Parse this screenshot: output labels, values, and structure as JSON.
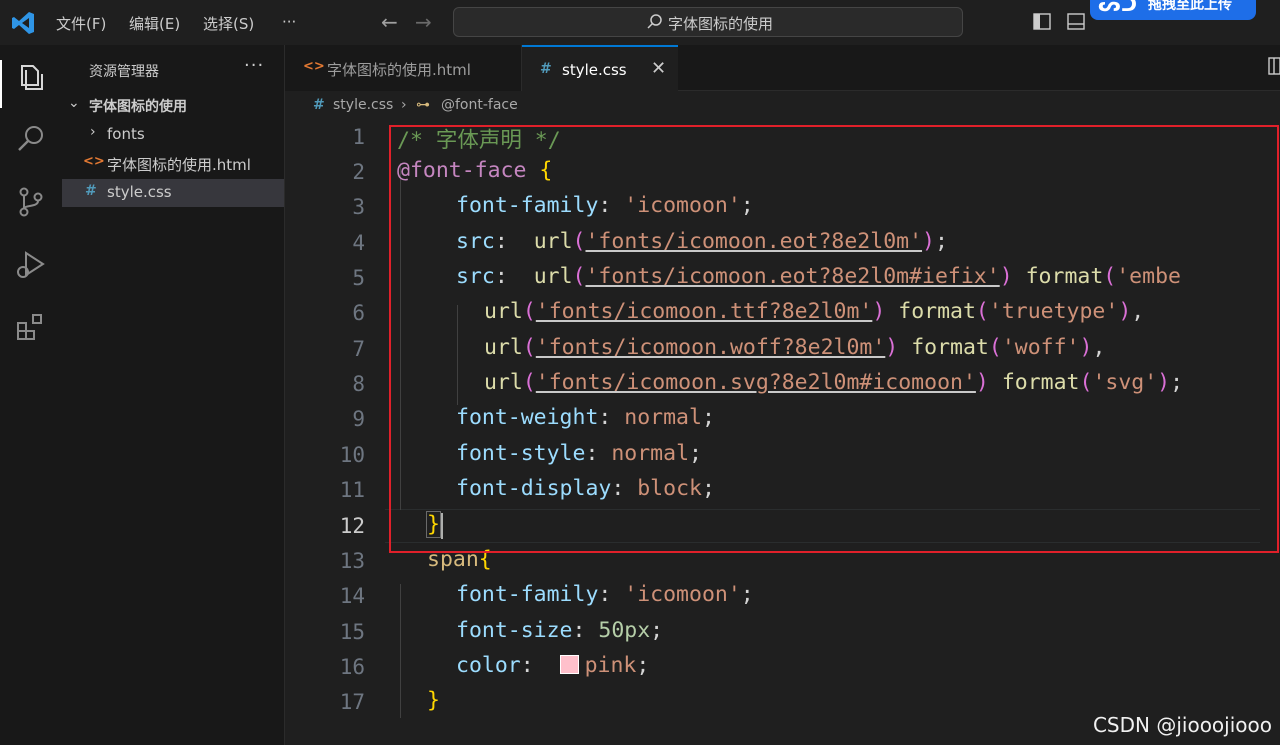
{
  "menubar": {
    "file": "文件(F)",
    "edit": "编辑(E)",
    "select": "选择(S)",
    "more": "···"
  },
  "command_center": {
    "text": "字体图标的使用"
  },
  "upload_badge": {
    "label": "拖拽至此上传"
  },
  "explorer": {
    "title": "资源管理器",
    "more": "···",
    "folder": "字体图标的使用",
    "items": [
      {
        "type": "folder",
        "label": "fonts"
      },
      {
        "type": "html",
        "label": "字体图标的使用.html"
      },
      {
        "type": "css",
        "label": "style.css"
      }
    ]
  },
  "tabs": [
    {
      "icon": "<>",
      "label": "字体图标的使用.html",
      "active": false
    },
    {
      "icon": "#",
      "label": "style.css",
      "active": true,
      "close": "✕"
    }
  ],
  "breadcrumb": {
    "file": "style.css",
    "separator": "›",
    "symbol": "@font-face"
  },
  "editor": {
    "line_numbers": [
      "1",
      "2",
      "3",
      "4",
      "5",
      "6",
      "7",
      "8",
      "9",
      "10",
      "11",
      "12",
      "13",
      "14",
      "15",
      "16",
      "17"
    ],
    "current_line": "12"
  },
  "code": {
    "l1": "/* 字体声明 */",
    "l2_at": "@font-face",
    "l3_prop": "font-family",
    "l3_val": "'icomoon'",
    "l4_prop": "src",
    "l4_fn": "url",
    "l4_str": "'fonts/icomoon.eot?8e2l0m'",
    "l5_prop": "src",
    "l5_fn": "url",
    "l5_str": "'fonts/icomoon.eot?8e2l0m#iefix'",
    "l5_fn2": "format",
    "l5_str2": "'embe",
    "l6_fn": "url",
    "l6_str": "'fonts/icomoon.ttf?8e2l0m'",
    "l6_fn2": "format",
    "l6_str2": "'truetype'",
    "l7_fn": "url",
    "l7_str": "'fonts/icomoon.woff?8e2l0m'",
    "l7_fn2": "format",
    "l7_str2": "'woff'",
    "l8_fn": "url",
    "l8_str": "'fonts/icomoon.svg?8e2l0m#icomoon'",
    "l8_fn2": "format",
    "l8_str2": "'svg'",
    "l9_prop": "font-weight",
    "l9_val": "normal",
    "l10_prop": "font-style",
    "l10_val": "normal",
    "l11_prop": "font-display",
    "l11_val": "block",
    "l13_sel": "span",
    "l14_prop": "font-family",
    "l14_val": "'icomoon'",
    "l15_prop": "font-size",
    "l15_val": "50px",
    "l16_prop": "color",
    "l16_val": "pink",
    "swatch_color": "#ffc0cb"
  },
  "watermark": "CSDN @jiooojiooo",
  "colors": {
    "accent": "#0078d4",
    "highlight_box": "#e0202a",
    "swatch": "#ffc0cb"
  }
}
